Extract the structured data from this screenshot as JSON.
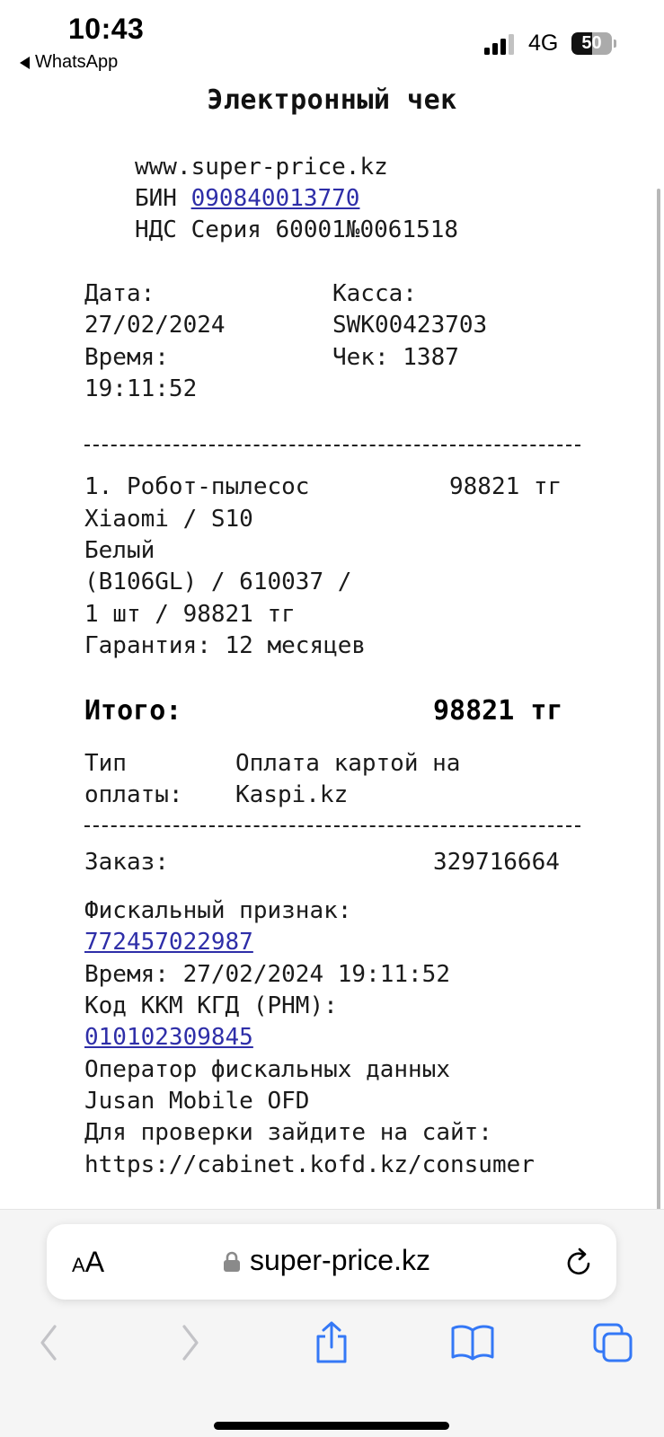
{
  "status_bar": {
    "time": "10:43",
    "back_app": "WhatsApp",
    "network": "4G",
    "battery_level": "50",
    "battery_fraction": 0.5,
    "signal_bars_active": 3,
    "signal_bars_total": 4
  },
  "receipt": {
    "title": "Электронный чек",
    "header": {
      "website": "www.super-price.kz",
      "bin_label": "БИН ",
      "bin_value": "090840013770",
      "nds": "НДС Серия 60001№0061518"
    },
    "info": {
      "date_label": "Дата:",
      "date_value": "27/02/2024",
      "time_label": "Время:",
      "time_value": "19:11:52",
      "kassa_label": "Касса:",
      "kassa_value": "SWK00423703",
      "check": "Чек: 1387"
    },
    "item": {
      "line1": "1. Робот-пылесос",
      "price": "98821 тг",
      "line2": "Xiaomi / S10",
      "line3": "Белый",
      "line4": "(B106GL) / 610037 /",
      "line5": "1 шт / 98821 тг",
      "warranty": "Гарантия: 12 месяцев"
    },
    "total": {
      "label": "Итого:",
      "value": "98821 тг"
    },
    "payment": {
      "label_line1": "Тип",
      "label_line2": "оплаты:",
      "value_line1": "Оплата картой на",
      "value_line2": "Kaspi.kz"
    },
    "order": {
      "label": "Заказ:",
      "value": "329716664"
    },
    "fiscal": {
      "sign_label": "Фискальный признак:",
      "sign_value": "772457022987",
      "time": "Время: 27/02/2024 19:11:52",
      "kkm_label": "Код ККМ КГД (РНМ):",
      "kkm_value": "010102309845",
      "operator_label": "Оператор фискальных данных",
      "operator_name": "Jusan Mobile OFD",
      "check_prompt": "Для проверки зайдите на сайт:",
      "check_url": "https://cabinet.kofd.kz/consumer"
    }
  },
  "browser": {
    "aa_small": "A",
    "aa_big": "A",
    "url": "super-price.kz",
    "toolbar_icons": [
      "back-icon",
      "forward-icon",
      "share-icon",
      "bookmarks-icon",
      "tabs-icon"
    ]
  }
}
